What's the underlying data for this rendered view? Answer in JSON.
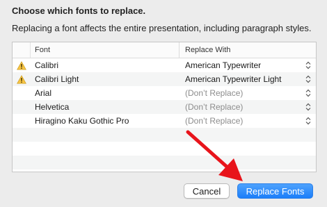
{
  "dialog": {
    "title": "Choose which fonts to replace.",
    "subtitle": "Replacing a font affects the entire presentation, including paragraph styles."
  },
  "table": {
    "col_font": "Font",
    "col_replace": "Replace With",
    "rows": [
      {
        "font": "Calibri",
        "replace": "American Typewriter",
        "warning": true
      },
      {
        "font": "Calibri Light",
        "replace": "American Typewriter Light",
        "warning": true
      },
      {
        "font": "Arial",
        "replace": "(Don’t Replace)",
        "warning": false
      },
      {
        "font": "Helvetica",
        "replace": "(Don’t Replace)",
        "warning": false
      },
      {
        "font": "Hiragino Kaku Gothic Pro",
        "replace": "(Don’t Replace)",
        "warning": false
      }
    ]
  },
  "buttons": {
    "cancel": "Cancel",
    "replace": "Replace Fonts"
  },
  "colors": {
    "accent": "#1b7ef9",
    "warning": "#f6c343",
    "annotation_arrow": "#e8141b"
  },
  "icons": {
    "warning": "warning-triangle-icon",
    "stepper": "up-down-stepper-icon"
  }
}
